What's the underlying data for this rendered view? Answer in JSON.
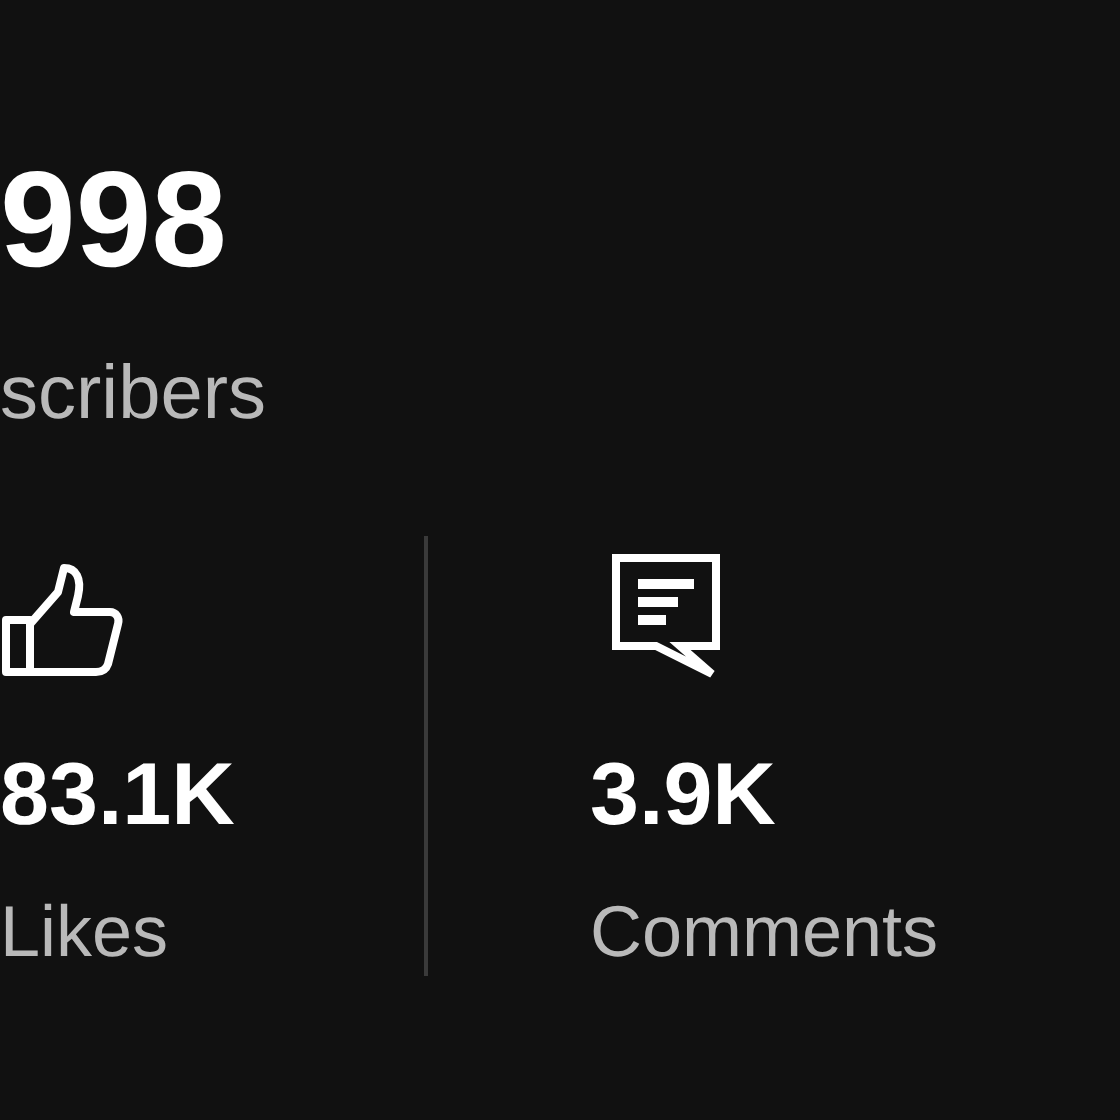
{
  "subscribers": {
    "count": "998",
    "label": "scribers"
  },
  "stats": [
    {
      "kind": "likes",
      "value": "83.1K",
      "label": "Likes"
    },
    {
      "kind": "comments",
      "value": "3.9K",
      "label": "Comments"
    }
  ]
}
